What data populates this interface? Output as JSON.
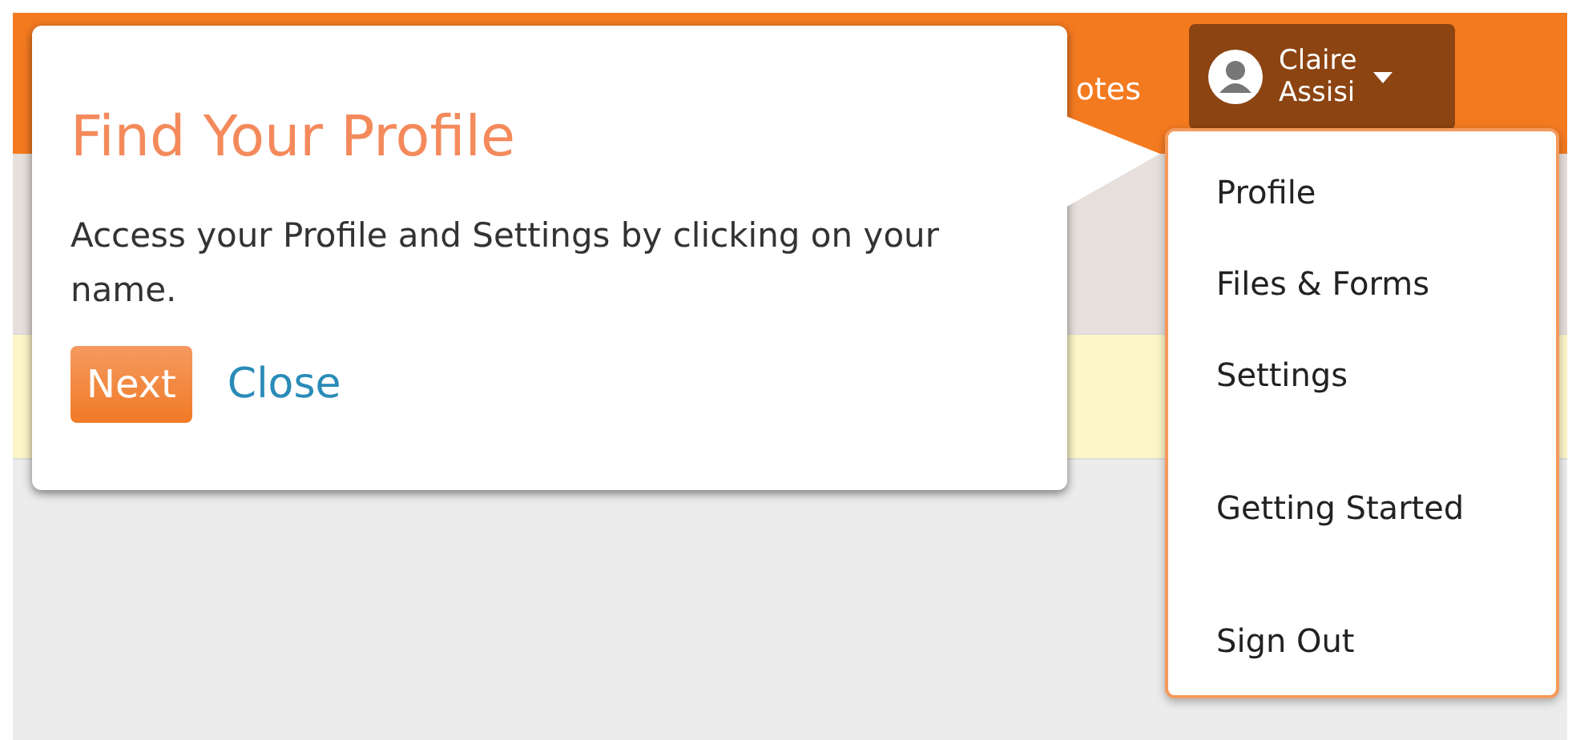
{
  "top_bar": {
    "nav_text": "otes",
    "user": {
      "first_name": "Claire",
      "last_name": "Assisi"
    }
  },
  "popover": {
    "title": "Find Your Profile",
    "body": "Access your Profile and Settings by clicking on your name.",
    "buttons": [
      {
        "label": "Next",
        "kind": "primary"
      },
      {
        "label": "Close",
        "kind": "link"
      }
    ]
  },
  "user_menu": {
    "sections": [
      {
        "items": [
          "Profile",
          "Files & Forms",
          "Settings"
        ]
      },
      {
        "items": [
          "Getting Started"
        ]
      },
      {
        "items": [
          "Sign Out"
        ]
      }
    ]
  }
}
